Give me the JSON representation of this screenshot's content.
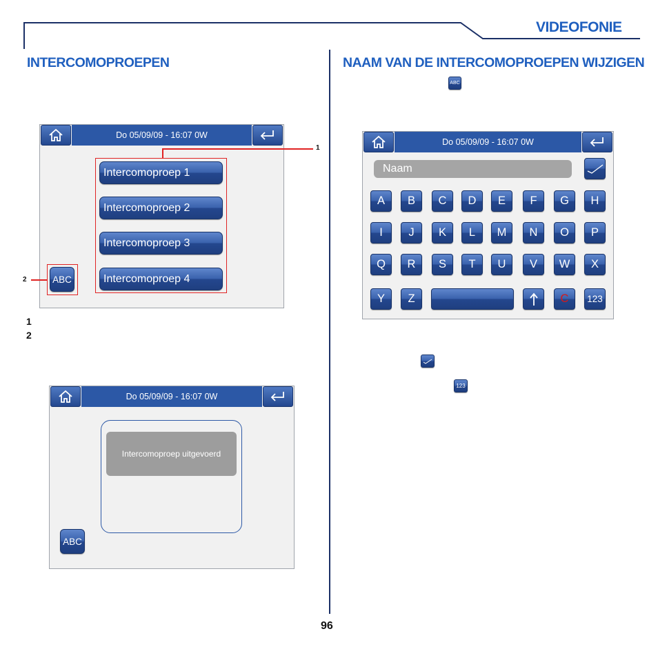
{
  "header": {
    "section": "VIDEOFONIE"
  },
  "left": {
    "title": "INTERCOMOPROEPEN",
    "screen1": {
      "datetime": "Do 05/09/09 - 16:07   0W",
      "buttons": [
        "Intercomoproep 1",
        "Intercomoproep 2",
        "Intercomoproep 3",
        "Intercomoproep 4"
      ],
      "abc_label": "ABC",
      "callout_1": "1",
      "callout_2": "2"
    },
    "legend": [
      "1",
      "2"
    ],
    "screen2": {
      "datetime": "Do 05/09/09 - 16:07   0W",
      "message": "Intercomoproep uitgevoerd",
      "abc_label": "ABC"
    }
  },
  "right": {
    "title": "NAAM VAN DE INTERCOMOPROEPEN WIJZIGEN",
    "inline_abc": "ABC",
    "keyboard_screen": {
      "datetime": "Do 05/09/09 - 16:07   0W",
      "name_field": "Naam",
      "rows": [
        [
          "A",
          "B",
          "C",
          "D",
          "E",
          "F",
          "G",
          "H"
        ],
        [
          "I",
          "J",
          "K",
          "L",
          "M",
          "N",
          "O",
          "P"
        ],
        [
          "Q",
          "R",
          "S",
          "T",
          "U",
          "V",
          "W",
          "X"
        ]
      ],
      "last_row": {
        "y": "Y",
        "z": "Z",
        "clear": "C",
        "numeric": "123"
      }
    },
    "inline_123": "123"
  },
  "footer": {
    "page_number": "96"
  },
  "colors": {
    "accent": "#1f5fbf",
    "bar": "#2c58a6",
    "callout": "#e02222",
    "divider": "#1a2f66"
  },
  "icons": [
    "home-icon",
    "back-arrow-icon",
    "checkmark-icon",
    "up-arrow-icon"
  ]
}
